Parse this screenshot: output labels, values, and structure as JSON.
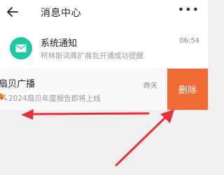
{
  "header": {
    "title": "消息中心",
    "more_label": "•••"
  },
  "messages": [
    {
      "title": "系统通知",
      "subtitle": "柯林斯词典扩展包开通成功提醒",
      "time": "06:54"
    },
    {
      "title": "扇贝广播",
      "subtitle": "2024扇贝年度报告即将上线",
      "time": "昨天"
    }
  ],
  "delete_label": "删除",
  "colors": {
    "accent": "#f36b34",
    "mail_avatar": "#1ec8a5",
    "annotation_arrow": "#e8303a"
  },
  "icons": {
    "back": "back-arrow-icon",
    "more": "more-icon",
    "mail": "mail-icon",
    "flower": "flower-icon"
  }
}
